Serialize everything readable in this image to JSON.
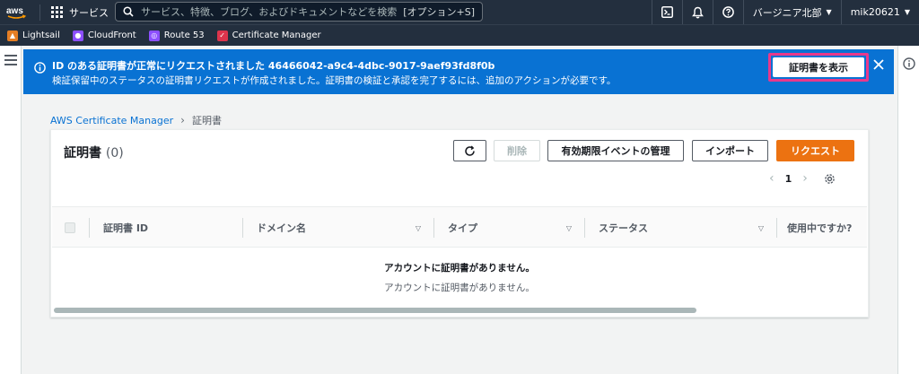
{
  "nav": {
    "services_label": "サービス",
    "search_placeholder": "サービス、特徴、ブログ、およびドキュメントなどを検索",
    "search_shortcut": "[オプション+S]",
    "region": "バージニア北部",
    "account": "mik20621"
  },
  "favorites": [
    {
      "label": "Lightsail",
      "color": "#e57e24"
    },
    {
      "label": "CloudFront",
      "color": "#8c4fff"
    },
    {
      "label": "Route 53",
      "color": "#8c4fff"
    },
    {
      "label": "Certificate Manager",
      "color": "#dd344c"
    }
  ],
  "flash": {
    "title": "ID のある証明書が正常にリクエストされました 46466042-a9c4-4dbc-9017-9aef93fd8f0b",
    "message": "検証保留中のステータスの証明書リクエストが作成されました。証明書の検証と承認を完了するには、追加のアクションが必要です。",
    "view_button": "証明書を表示",
    "bg_color": "#0972d3",
    "highlight_color": "#e8398b"
  },
  "breadcrumb": {
    "root": "AWS Certificate Manager",
    "current": "証明書"
  },
  "panel": {
    "title": "証明書",
    "count": "(0)",
    "buttons": {
      "delete": "削除",
      "manage": "有効期限イベントの管理",
      "import": "インポート",
      "request": "リクエスト"
    },
    "page": "1",
    "columns": [
      "証明書 ID",
      "ドメイン名",
      "タイプ",
      "ステータス",
      "使用中ですか?"
    ],
    "empty_title": "アカウントに証明書がありません。",
    "empty_message": "アカウントに証明書がありません。",
    "accent_color": "#ec7211"
  }
}
